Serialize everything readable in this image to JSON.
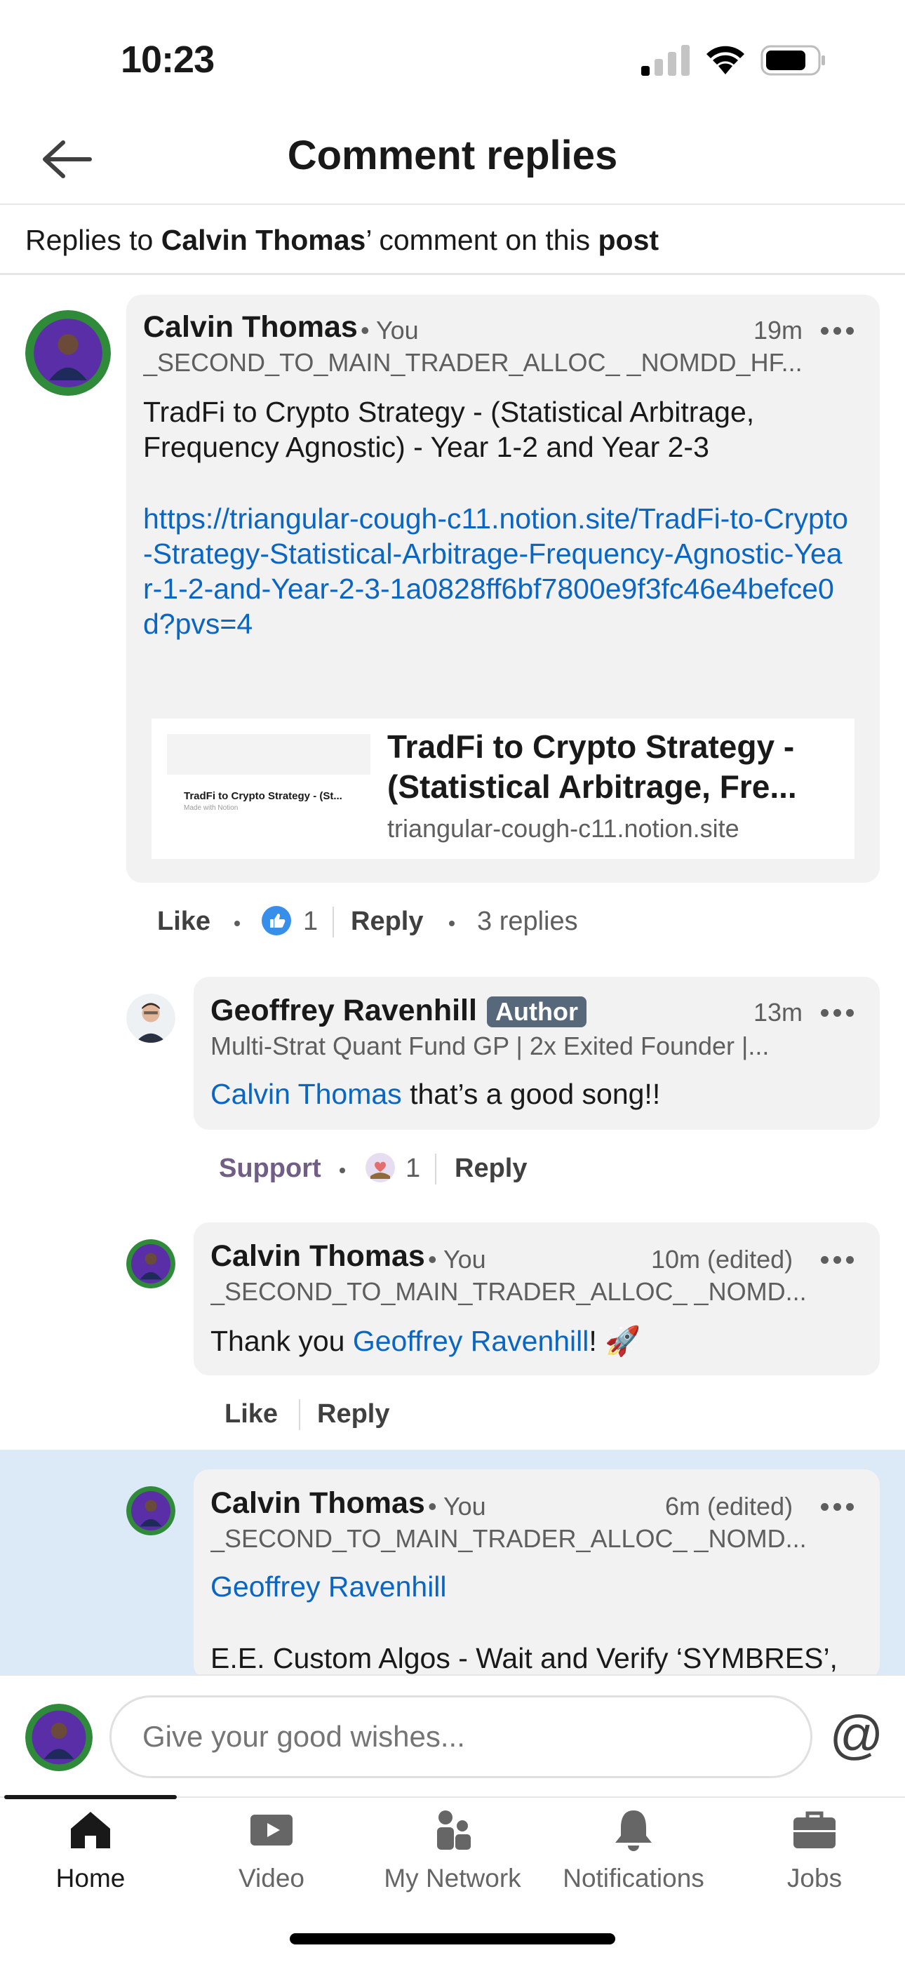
{
  "status_bar": {
    "time": "10:23"
  },
  "header": {
    "title": "Comment replies"
  },
  "subheader": {
    "prefix": "Replies to ",
    "name": "Calvin Thomas",
    "middle": "’ comment on this ",
    "post": "post"
  },
  "main_comment": {
    "author": "Calvin Thomas",
    "you": "• You",
    "time": "19m",
    "headline": "_SECOND_TO_MAIN_TRADER_ALLOC_ _NOMDD_HF...",
    "text_line1": "TradFi to Crypto Strategy - (Statistical Arbitrage,",
    "text_line2": "Frequency Agnostic) - Year 1-2 and Year 2-3",
    "link": "https://triangular-cough-c11.notion.site/TradFi-to-Crypto-Strategy-Statistical-Arbitrage-Frequency-Agnostic-Year-1-2-and-Year-2-3-1a0828ff6bf7800e9f3fc46e4befce0d?pvs=4",
    "preview": {
      "thumb_title": "TradFi to Crypto Strategy - (St...",
      "thumb_sub": "Made with Notion",
      "title_line1": "TradFi to Crypto Strategy -",
      "title_line2": "(Statistical Arbitrage, Fre...",
      "domain": "triangular-cough-c11.notion.site"
    },
    "actions": {
      "like": "Like",
      "reaction_count": "1",
      "reply": "Reply",
      "replies": "3 replies"
    }
  },
  "replies": [
    {
      "author": "Geoffrey Ravenhill",
      "badge": "Author",
      "time": "13m",
      "headline": "Multi-Strat Quant Fund GP | 2x Exited Founder |...",
      "mention": "Calvin Thomas",
      "text": " that’s a good song!!",
      "actions": {
        "reaction": "Support",
        "reaction_count": "1",
        "reply": "Reply"
      }
    },
    {
      "author": "Calvin Thomas",
      "you": "• You",
      "time": "10m (edited)",
      "headline": "_SECOND_TO_MAIN_TRADER_ALLOC_ _NOMD...",
      "prefix": "Thank you ",
      "mention": "Geoffrey Ravenhill",
      "suffix": "! 🚀",
      "actions": {
        "like": "Like",
        "reply": "Reply"
      }
    },
    {
      "author": "Calvin Thomas",
      "you": "• You",
      "time": "6m (edited)",
      "headline": "_SECOND_TO_MAIN_TRADER_ALLOC_ _NOMD...",
      "mention": "Geoffrey Ravenhill",
      "text": "E.E. Custom Algos - Wait and Verify ‘SYMBRES’,"
    }
  ],
  "composer": {
    "placeholder": "Give your good wishes...",
    "at_symbol": "@"
  },
  "bottom_nav": [
    {
      "label": "Home",
      "icon": "home-icon",
      "active": true
    },
    {
      "label": "Video",
      "icon": "video-icon",
      "active": false
    },
    {
      "label": "My Network",
      "icon": "network-icon",
      "active": false
    },
    {
      "label": "Notifications",
      "icon": "bell-icon",
      "active": false
    },
    {
      "label": "Jobs",
      "icon": "briefcase-icon",
      "active": false
    }
  ],
  "colors": {
    "link": "#0a66c2",
    "highlight": "#dce9f7",
    "bubble": "#f2f2f2",
    "support": "#715e86"
  }
}
